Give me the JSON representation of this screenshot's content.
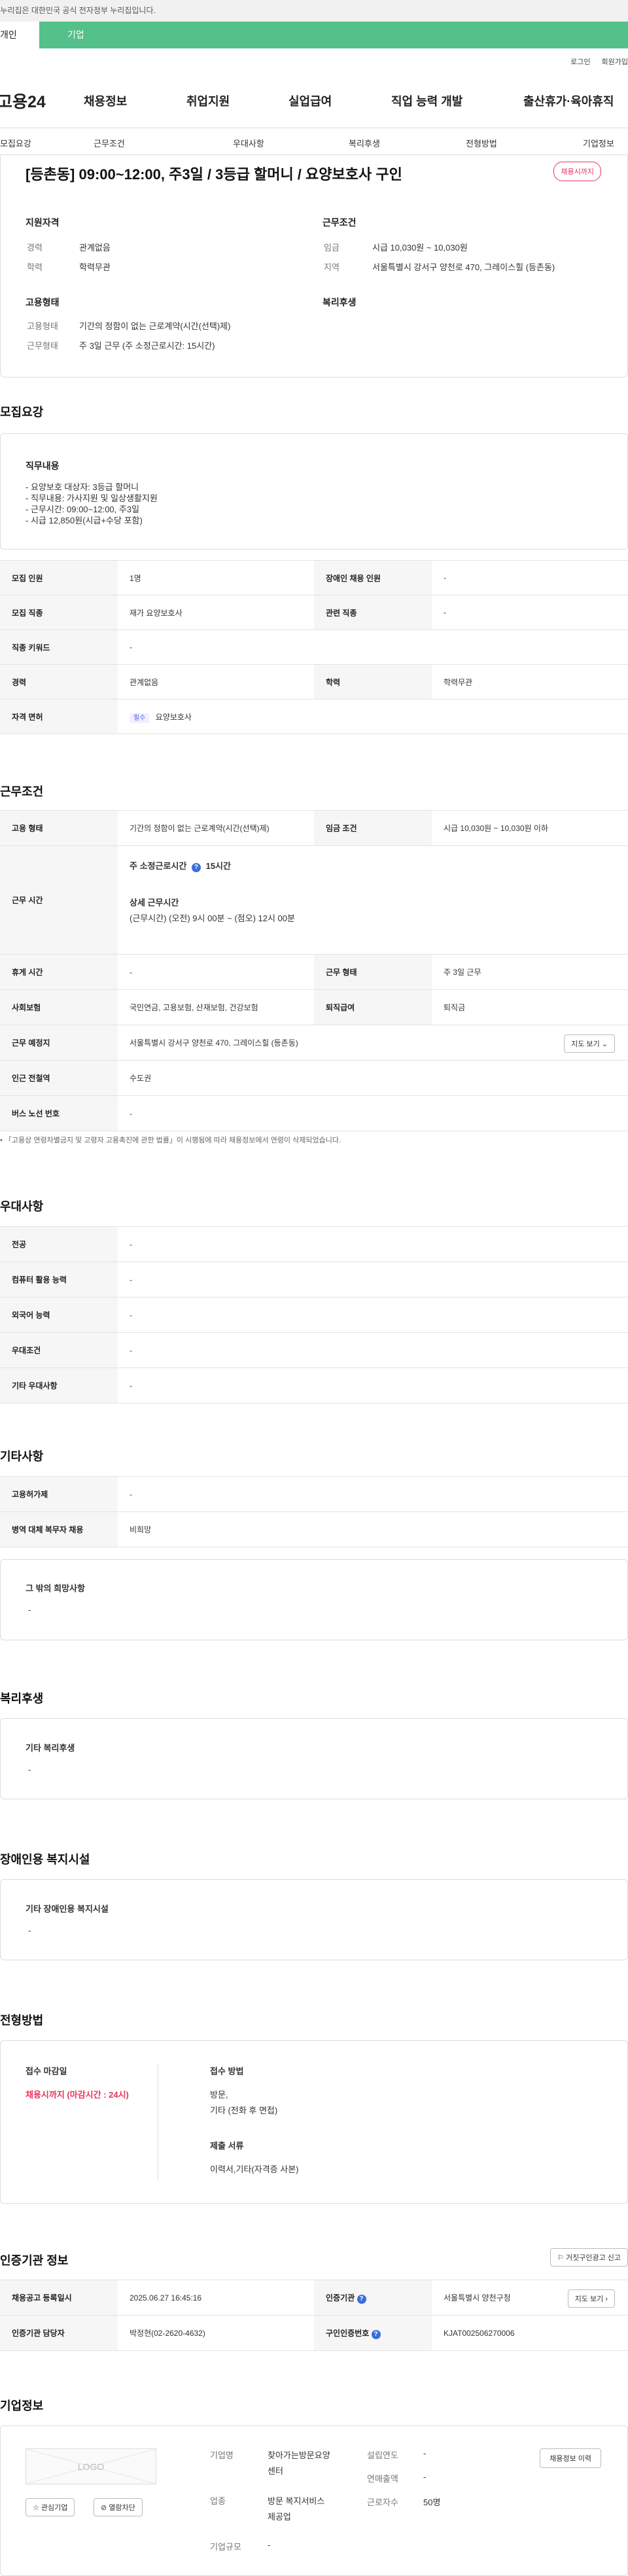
{
  "gov_banner": "이 누리집은 대한민국 공식 전자정부 누리집입니다.",
  "tabs": {
    "individual": "개인",
    "company": "기업"
  },
  "util": {
    "login": "로그인",
    "join": "회원가입"
  },
  "logo": "고용24",
  "gnb": [
    "채용정보",
    "취업지원",
    "실업급여",
    "직업 능력 개발",
    "출산휴가·육아휴직"
  ],
  "subnav": [
    "모집요강",
    "근무조건",
    "우대사항",
    "복리후생",
    "전형방법",
    "기업정보"
  ],
  "header": {
    "title": "[등촌동] 09:00~12:00, 주3일 / 3등급 할머니 / 요양보호사 구인",
    "badge": "채용시까지",
    "qual_title": "지원자격",
    "cond_title": "근무조건",
    "career_label": "경력",
    "career_value": "관계없음",
    "edu_label": "학력",
    "edu_value": "학력무관",
    "wage_label": "임금",
    "wage_value": "시급 10,030원 ~ 10,030원",
    "region_label": "지역",
    "region_value": "서울특별시 강서구 양천로 470, 그레이스힐 (등촌동)",
    "emp_title": "고용형태",
    "welfare_title": "복리후생",
    "emp_type_label": "고용형태",
    "emp_type_value": "기간의 정함이 없는 근로계약(시간(선택)제)",
    "work_type_label": "근무형태",
    "work_type_value": "주 3일 근무 (주 소정근로시간: 15시간)"
  },
  "recruit": {
    "section": "모집요강",
    "duty_title": "직무내용",
    "duty_lines": [
      "- 요양보호 대상자: 3등급 할머니",
      "- 직무내용: 가사지원 및 일상생활지원",
      "- 근무시간: 09:00~12:00, 주3일",
      "- 시급 12,850원(시급+수당 포함)"
    ],
    "rows": {
      "headcount_label": "모집 인원",
      "headcount": "1명",
      "disabled_label": "장애인 채용 인원",
      "disabled": "-",
      "job_label": "모집 직종",
      "job": "재가 요양보호사",
      "related_label": "관련 직종",
      "related": "-",
      "keyword_label": "직종 키워드",
      "keyword": "-",
      "career_label": "경력",
      "career": "관계없음",
      "edu_label": "학력",
      "edu": "학력무관",
      "license_label": "자격 면허",
      "license_tag": "필수",
      "license": "요양보호사"
    }
  },
  "conditions": {
    "section": "근무조건",
    "emp_label": "고용 형태",
    "emp": "기간의 정함이 없는 근로계약(시간(선택)제)",
    "wage_label": "임금 조건",
    "wage": "시급 10,030원 ~ 10,030원 이하",
    "time_label": "근무 시간",
    "weekly_hours_label": "주 소정근로시간",
    "weekly_hours": "15시간",
    "detail_label": "상세 근무시간",
    "detail": "(근무시간) (오전) 9시 00분 ~ (점오) 12시 00분",
    "rest_label": "휴게 시간",
    "rest": "-",
    "worktype_label": "근무 형태",
    "worktype": "주 3일 근무",
    "insurance_label": "사회보험",
    "insurance": "국민연금, 고용보험, 산재보험, 건강보험",
    "severance_label": "퇴직급여",
    "severance": "퇴직금",
    "place_label": "근무 예정지",
    "place": "서울특별시 강서구 양천로 470, 그레이스힐 (등촌동)",
    "map_btn": "지도 보기",
    "metro_label": "인근 전철역",
    "metro": "수도권",
    "bus_label": "버스 노선 번호",
    "bus": "-",
    "notice": "「고용상 연령차별금지 및 고령자 고용촉진에 관한 법률」이 시행됨에 따라 채용정보에서 연령이 삭제되었습니다."
  },
  "prefer": {
    "section": "우대사항",
    "major_label": "전공",
    "major": "-",
    "computer_label": "컴퓨터 활용 능력",
    "computer": "-",
    "lang_label": "외국어 능력",
    "lang": "-",
    "pref_label": "우대조건",
    "pref": "-",
    "etc_label": "기타 우대사항",
    "etc": "-"
  },
  "etc": {
    "section": "기타사항",
    "permit_label": "고용허가제",
    "permit": "-",
    "military_label": "병역 대체 복무자 채용",
    "military": "비희망",
    "wish_title": "그 밖의 희망사항",
    "wish": "-"
  },
  "welfare": {
    "section": "복리후생",
    "title": "기타 복리후생",
    "value": "-"
  },
  "facility": {
    "section": "장애인용 복지시설",
    "title": "기타 장애인용 복지시설",
    "value": "-"
  },
  "screening": {
    "section": "전형방법",
    "deadline_title": "접수 마감일",
    "deadline": "채용시까지 (마감시간 : 24시)",
    "method_title": "접수 방법",
    "method1": "방문,",
    "method2": "기타 (전화 후 면접)",
    "docs_title": "제출 서류",
    "docs": "이력서,기타(자격증 사본)"
  },
  "cert": {
    "section": "인증기관 정보",
    "report_btn": "거짓구인광고 신고",
    "reg_label": "채용공고 등록일시",
    "reg": "2025.06.27 16:45:16",
    "agency_label": "인증기관",
    "agency": "서울특별시 양천구청",
    "map_btn": "지도 보기",
    "officer_label": "인증기관 담당자",
    "officer": "박정현(02-2620-4632)",
    "no_label": "구인인증번호",
    "no": "KJAT002506270006"
  },
  "company": {
    "section": "기업정보",
    "logo_text": "LOGO",
    "fav_btn": "관심기업",
    "block_btn": "열람차단",
    "name_label": "기업명",
    "name1": "찾아가는방문요양",
    "name2": "센터",
    "industry_label": "업종",
    "industry1": "방문 복지서비스",
    "industry2": "제공업",
    "size_label": "기업규모",
    "size": "-",
    "founded_label": "설립연도",
    "founded": "-",
    "revenue_label": "연매출액",
    "revenue": "-",
    "employees_label": "근로자수",
    "employees": "50명",
    "history_btn": "채용정보 이력"
  }
}
